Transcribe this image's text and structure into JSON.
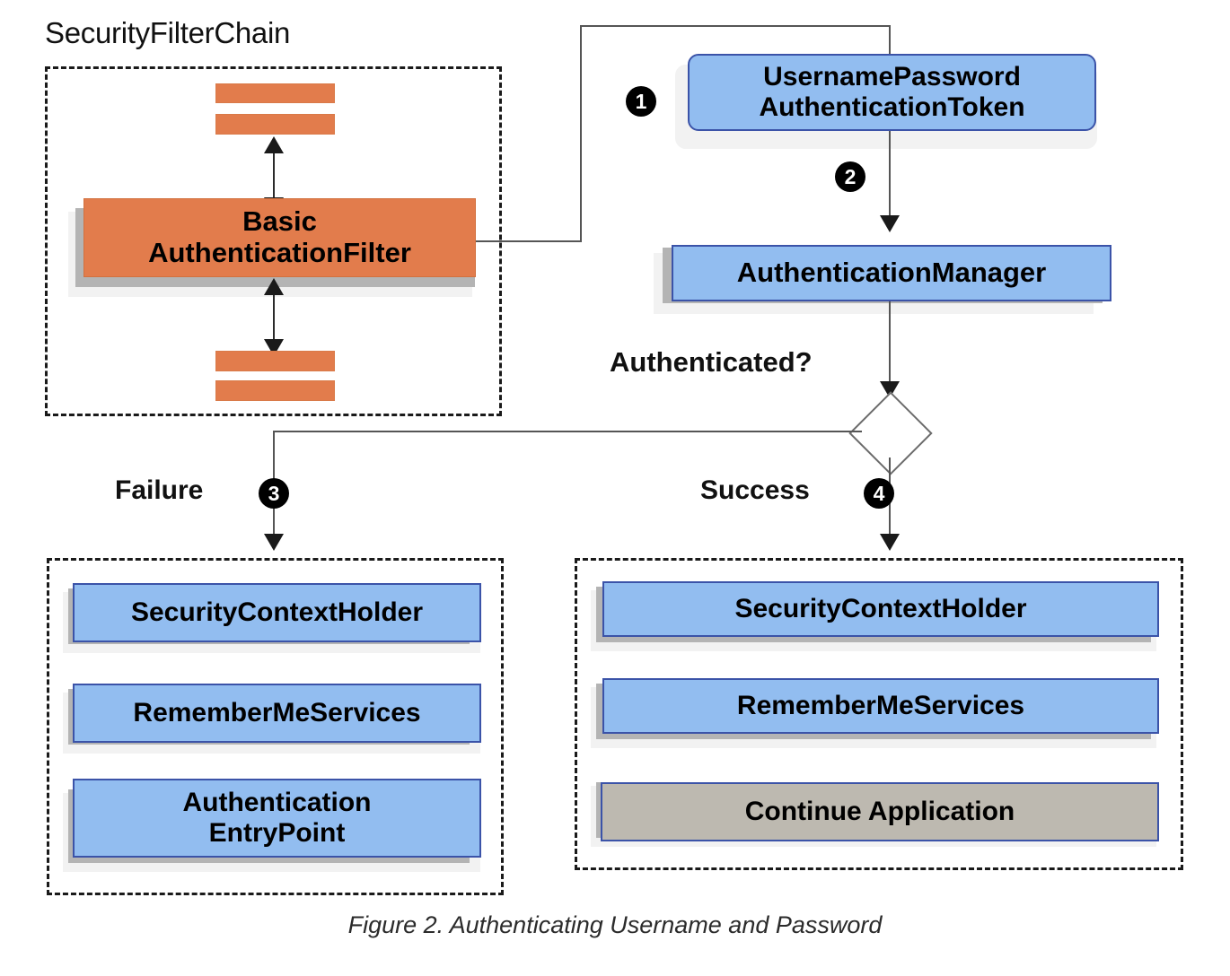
{
  "figure": {
    "caption": "Figure 2. Authenticating Username and Password"
  },
  "filter_chain": {
    "title": "SecurityFilterChain",
    "main_filter_line1": "Basic",
    "main_filter_line2": "AuthenticationFilter",
    "placeholder_filters": [
      "",
      "",
      "",
      ""
    ],
    "colors": {
      "node_fill": "#E27C4C",
      "node_border": "#d2713f"
    }
  },
  "flow": {
    "token": {
      "line1": "UsernamePassword",
      "line2": "AuthenticationToken"
    },
    "manager": {
      "label": "AuthenticationManager"
    },
    "decision": {
      "label": "Authenticated?"
    },
    "branches": {
      "failure_label": "Failure",
      "success_label": "Success"
    },
    "steps": {
      "one": "1",
      "two": "2",
      "three": "3",
      "four": "4"
    }
  },
  "failure_group": {
    "items": [
      {
        "label": "SecurityContextHolder",
        "kind": "blue",
        "lines": 1
      },
      {
        "label": "RememberMeServices",
        "kind": "blue",
        "lines": 1
      },
      {
        "label_line1": "Authentication",
        "label_line2": "EntryPoint",
        "kind": "blue",
        "lines": 2
      }
    ]
  },
  "success_group": {
    "items": [
      {
        "label": "SecurityContextHolder",
        "kind": "blue"
      },
      {
        "label": "RememberMeServices",
        "kind": "blue"
      },
      {
        "label": "Continue Application",
        "kind": "gray"
      }
    ]
  },
  "colors": {
    "blue_fill": "#92BDF0",
    "blue_border": "#3b53a8",
    "gray_fill": "#BDB9B0",
    "orange_fill": "#E27C4C",
    "line": "#2b2b2b"
  }
}
